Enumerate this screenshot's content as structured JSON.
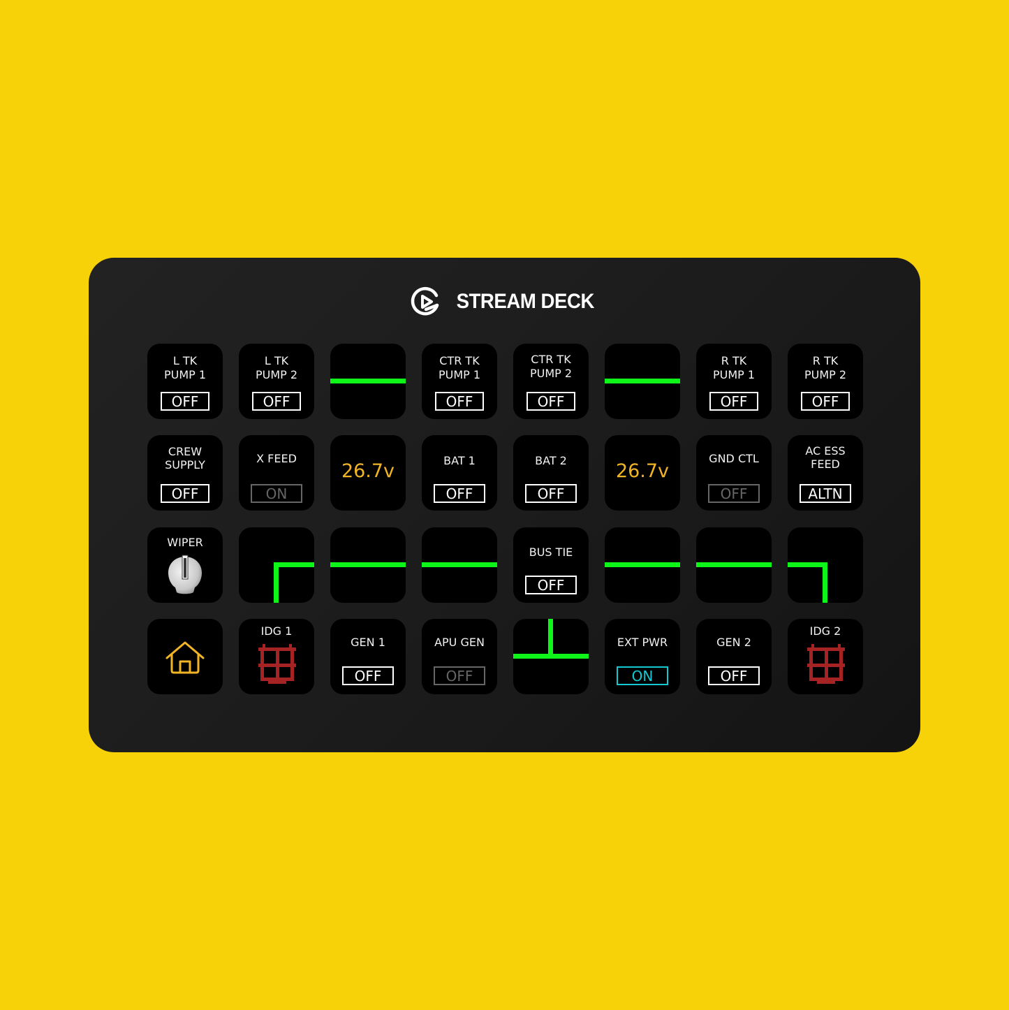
{
  "brand": {
    "name": "STREAM DECK",
    "logo": "elgato-logo-icon"
  },
  "colors": {
    "background": "#f7d208",
    "device": "#1c1c1c",
    "key": "#000000",
    "bus_line": "#0ef51a",
    "voltage": "#f1b425",
    "on_cyan": "#14c8d2",
    "idg_red": "#a52323"
  },
  "keys": {
    "l_tk_pump_1": {
      "label1": "L TK",
      "label2": "PUMP 1",
      "state": "OFF"
    },
    "l_tk_pump_2": {
      "label1": "L TK",
      "label2": "PUMP 2",
      "state": "OFF"
    },
    "ctr_tk_pump_1": {
      "label1": "CTR TK",
      "label2": "PUMP 1",
      "state": "OFF"
    },
    "ctr_tk_pump_2": {
      "label1": "CTR TK",
      "label2": "PUMP 2",
      "state": "OFF"
    },
    "r_tk_pump_1": {
      "label1": "R TK",
      "label2": "PUMP 1",
      "state": "OFF"
    },
    "r_tk_pump_2": {
      "label1": "R TK",
      "label2": "PUMP 2",
      "state": "OFF"
    },
    "crew_supply": {
      "label1": "CREW",
      "label2": "SUPPLY",
      "state": "OFF"
    },
    "x_feed": {
      "label": "X FEED",
      "state": "ON",
      "style": "dim"
    },
    "bat_1_voltage": {
      "value": "26.7v"
    },
    "bat_1": {
      "label": "BAT 1",
      "state": "OFF"
    },
    "bat_2": {
      "label": "BAT 2",
      "state": "OFF"
    },
    "bat_2_voltage": {
      "value": "26.7v"
    },
    "gnd_ctl": {
      "label": "GND CTL",
      "state": "OFF",
      "style": "dim"
    },
    "ac_ess_feed": {
      "label1": "AC ESS",
      "label2": "FEED",
      "state": "ALTN"
    },
    "wiper": {
      "label": "WIPER",
      "icon": "rotary-knob-icon"
    },
    "bus_tie": {
      "label": "BUS TIE",
      "state": "OFF"
    },
    "home": {
      "icon": "home-icon"
    },
    "idg_1": {
      "label": "IDG 1",
      "icon": "idg-guard-icon"
    },
    "gen_1": {
      "label": "GEN 1",
      "state": "OFF"
    },
    "apu_gen": {
      "label": "APU GEN",
      "state": "OFF",
      "style": "dim"
    },
    "ext_pwr": {
      "label": "EXT PWR",
      "state": "ON",
      "style": "cyan"
    },
    "gen_2": {
      "label": "GEN 2",
      "state": "OFF"
    },
    "idg_2": {
      "label": "IDG 2",
      "icon": "idg-guard-icon"
    }
  }
}
